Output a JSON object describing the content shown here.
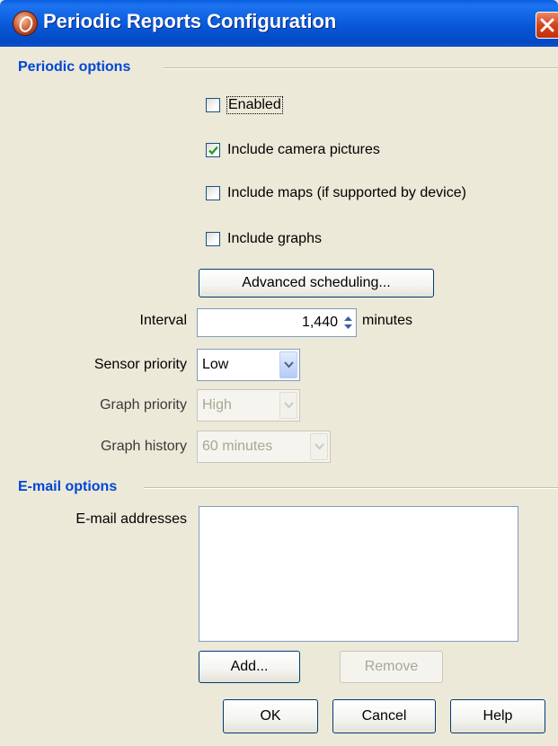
{
  "window": {
    "title": "Periodic Reports Configuration"
  },
  "periodic": {
    "section_title": "Periodic options",
    "enabled": {
      "label": "Enabled",
      "checked": false
    },
    "camera": {
      "label": "Include camera pictures",
      "checked": true
    },
    "maps": {
      "label": "Include maps (if supported by device)",
      "checked": false
    },
    "graphs": {
      "label": "Include graphs",
      "checked": false
    },
    "advanced_label": "Advanced scheduling...",
    "interval": {
      "label": "Interval",
      "value": "1,440",
      "unit": "minutes"
    },
    "sensor_priority": {
      "label": "Sensor priority",
      "value": "Low"
    },
    "graph_priority": {
      "label": "Graph priority",
      "value": "High"
    },
    "graph_history": {
      "label": "Graph history",
      "value": "60 minutes"
    }
  },
  "email": {
    "section_title": "E-mail options",
    "addresses_label": "E-mail addresses",
    "add_label": "Add...",
    "remove_label": "Remove"
  },
  "footer": {
    "ok_label": "OK",
    "cancel_label": "Cancel",
    "help_label": "Help"
  },
  "colors": {
    "title_bar": "#0858d8",
    "section_title": "#0046d5",
    "check_mark": "#21a121",
    "close": "#d4441c"
  }
}
